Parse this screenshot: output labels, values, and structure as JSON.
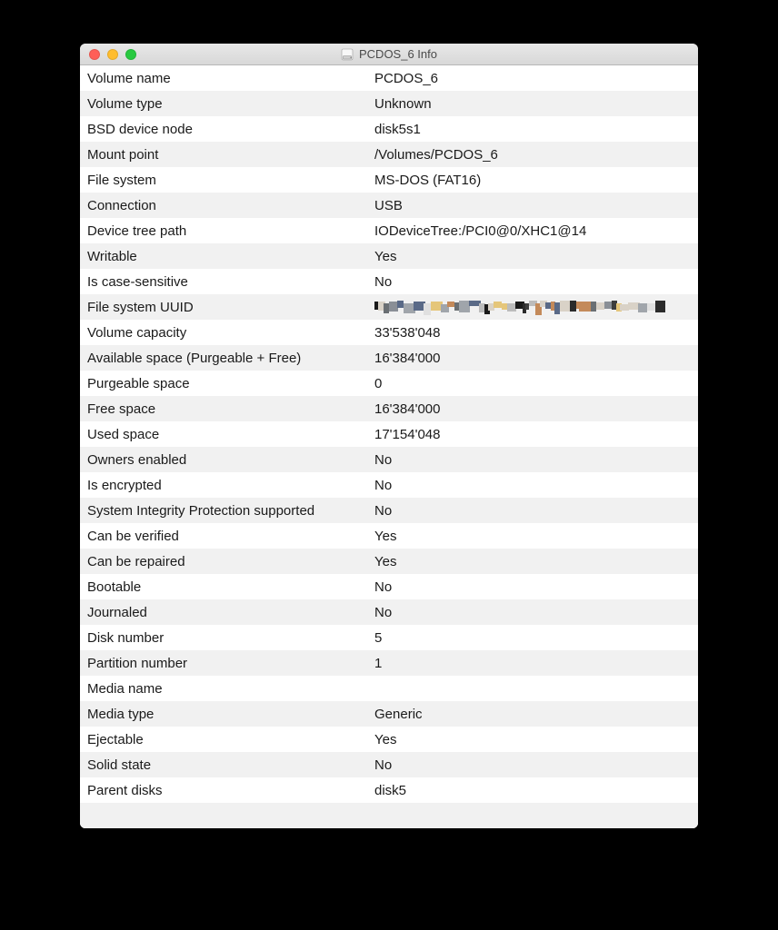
{
  "window": {
    "title": "PCDOS_6 Info",
    "icon": "disk-icon"
  },
  "rows": [
    {
      "label": "Volume name",
      "value": "PCDOS_6"
    },
    {
      "label": "Volume type",
      "value": "Unknown"
    },
    {
      "label": "BSD device node",
      "value": "disk5s1"
    },
    {
      "label": "Mount point",
      "value": "/Volumes/PCDOS_6"
    },
    {
      "label": "File system",
      "value": "MS-DOS (FAT16)"
    },
    {
      "label": "Connection",
      "value": "USB"
    },
    {
      "label": "Device tree path",
      "value": "IODeviceTree:/PCI0@0/XHC1@14"
    },
    {
      "label": "Writable",
      "value": "Yes"
    },
    {
      "label": "Is case-sensitive",
      "value": "No"
    },
    {
      "label": "File system UUID",
      "value": "",
      "redacted": true
    },
    {
      "label": "Volume capacity",
      "value": "33'538'048"
    },
    {
      "label": "Available space (Purgeable + Free)",
      "value": "16'384'000"
    },
    {
      "label": "Purgeable space",
      "value": "0"
    },
    {
      "label": "Free space",
      "value": "16'384'000"
    },
    {
      "label": "Used space",
      "value": "17'154'048"
    },
    {
      "label": "Owners enabled",
      "value": "No"
    },
    {
      "label": "Is encrypted",
      "value": "No"
    },
    {
      "label": "System Integrity Protection supported",
      "value": "No"
    },
    {
      "label": "Can be verified",
      "value": "Yes"
    },
    {
      "label": "Can be repaired",
      "value": "Yes"
    },
    {
      "label": "Bootable",
      "value": "No"
    },
    {
      "label": "Journaled",
      "value": "No"
    },
    {
      "label": "Disk number",
      "value": "5"
    },
    {
      "label": "Partition number",
      "value": "1"
    },
    {
      "label": "Media name",
      "value": ""
    },
    {
      "label": "Media type",
      "value": "Generic"
    },
    {
      "label": "Ejectable",
      "value": "Yes"
    },
    {
      "label": "Solid state",
      "value": "No"
    },
    {
      "label": "Parent disks",
      "value": "disk5"
    }
  ]
}
